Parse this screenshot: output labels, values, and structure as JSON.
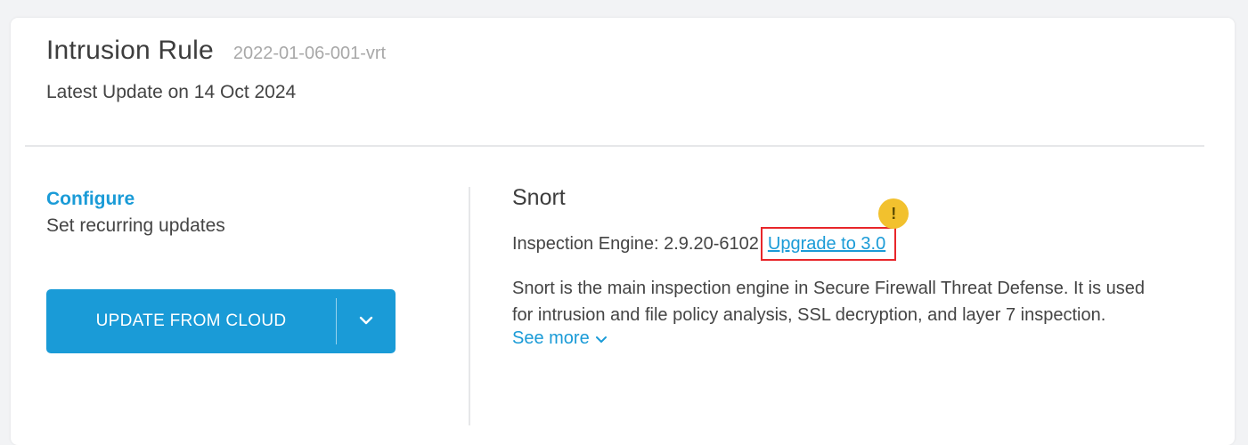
{
  "header": {
    "title": "Intrusion Rule",
    "version": "2022-01-06-001-vrt",
    "latest_update": "Latest Update on 14 Oct 2024"
  },
  "left": {
    "configure_label": "Configure",
    "recurring_text": "Set recurring updates",
    "update_button_label": "UPDATE FROM CLOUD"
  },
  "right": {
    "title": "Snort",
    "engine_label": "Inspection Engine: 2.9.20-6102",
    "upgrade_link": "Upgrade to 3.0",
    "warning_symbol": "!",
    "description": "Snort is the main inspection engine in Secure Firewall Threat Defense. It is used for intrusion and file policy analysis, SSL decryption, and layer 7 inspection.",
    "see_more": "See more"
  },
  "icons": {
    "dropdown": "chevron-down-icon",
    "see_more": "chevron-down-icon",
    "warning": "warning-icon"
  },
  "colors": {
    "accent": "#1a9bd7",
    "highlight_border": "#e8262a",
    "warning": "#f2c12e"
  }
}
